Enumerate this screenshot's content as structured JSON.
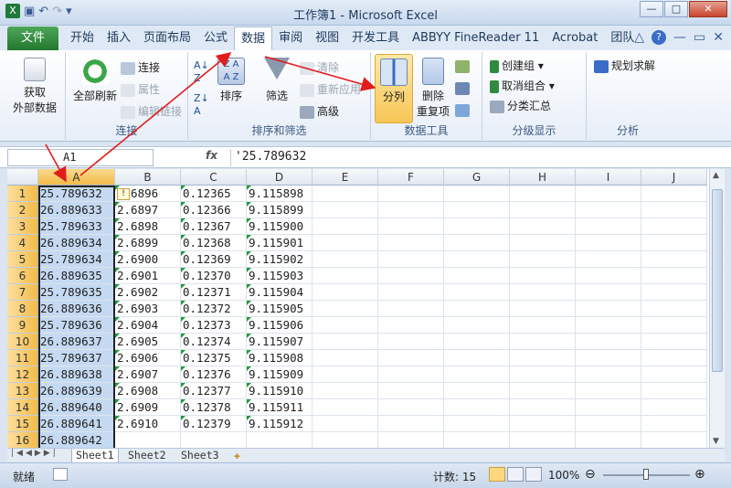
{
  "window": {
    "title": "工作簿1 - Microsoft Excel"
  },
  "tabs": [
    "文件",
    "开始",
    "插入",
    "页面布局",
    "公式",
    "数据",
    "审阅",
    "视图",
    "开发工具",
    "ABBYY FineReader 11",
    "Acrobat",
    "团队"
  ],
  "ribbon": {
    "get_external": "获取\n外部数据",
    "connections": {
      "refresh_all": "全部刷新",
      "connect": "连接",
      "properties": "属性",
      "edit_links": "编辑链接",
      "group_label": "连接"
    },
    "sort_filter": {
      "sort": "排序",
      "filter": "筛选",
      "clear": "清除",
      "reapply": "重新应用",
      "advanced": "高级",
      "group_label": "排序和筛选"
    },
    "data_tools": {
      "text_to_columns": "分列",
      "remove_dup": "删除\n重复项",
      "group_label": "数据工具"
    },
    "outline": {
      "group": "创建组",
      "ungroup": "取消组合",
      "subtotal": "分类汇总",
      "group_label": "分级显示"
    },
    "analysis": {
      "solver": "规划求解",
      "group_label": "分析"
    }
  },
  "formula_bar": {
    "name_box": "A1",
    "fx": "fx",
    "formula": "'25.789632"
  },
  "columns": [
    "A",
    "B",
    "C",
    "D",
    "E",
    "F",
    "G",
    "H",
    "I",
    "J"
  ],
  "rows": [
    "1",
    "2",
    "3",
    "4",
    "5",
    "6",
    "7",
    "8",
    "9",
    "10",
    "11",
    "12",
    "13",
    "14",
    "15",
    "16"
  ],
  "cells": {
    "A": [
      "25.789632",
      "26.889633",
      "25.789633",
      "26.889634",
      "25.789634",
      "26.889635",
      "25.789635",
      "26.889636",
      "25.789636",
      "26.889637",
      "25.789637",
      "26.889638",
      "26.889639",
      "26.889640",
      "26.889641",
      "26.889642"
    ],
    "B": [
      "2.6896",
      "2.6897",
      "2.6898",
      "2.6899",
      "2.6900",
      "2.6901",
      "2.6902",
      "2.6903",
      "2.6904",
      "2.6905",
      "2.6906",
      "2.6907",
      "2.6908",
      "2.6909",
      "2.6910"
    ],
    "C": [
      "0.12365",
      "0.12366",
      "0.12367",
      "0.12368",
      "0.12369",
      "0.12370",
      "0.12371",
      "0.12372",
      "0.12373",
      "0.12374",
      "0.12375",
      "0.12376",
      "0.12377",
      "0.12378",
      "0.12379"
    ],
    "D": [
      "9.115898",
      "9.115899",
      "9.115900",
      "9.115901",
      "9.115902",
      "9.115903",
      "9.115904",
      "9.115905",
      "9.115906",
      "9.115907",
      "9.115908",
      "9.115909",
      "9.115910",
      "9.115911",
      "9.115912"
    ]
  },
  "sheets": [
    "Sheet1",
    "Sheet2",
    "Sheet3"
  ],
  "status": {
    "ready": "就绪",
    "count": "计数: 15",
    "zoom": "100%"
  },
  "colors": {
    "file_tab": "#2e8b3e",
    "highlight": "#f7c656",
    "selection": "#c5daf2",
    "arrow": "#e21b1b"
  }
}
